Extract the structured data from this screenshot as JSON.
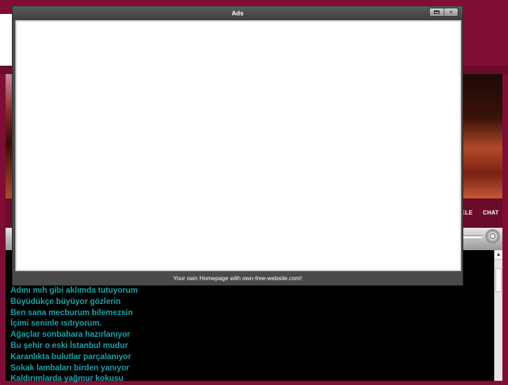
{
  "popup": {
    "title": "Ads",
    "footer_text": "Your own Homepage with own-free-website.com!",
    "maximize_icon": "maximize-icon",
    "close_label": "×"
  },
  "nav": {
    "items": [
      {
        "label": "ELE"
      },
      {
        "label": "CHAT"
      }
    ]
  },
  "player": {
    "knob_icon": "volume-knob-icon"
  },
  "scrollbar": {
    "up_arrow": "▲"
  },
  "lyrics": [
    "Adını mıh gibi aklımda tutuyorum",
    "Büyüdükçe büyüyor gözlerin",
    "Ben sana mecburum bilemezsin",
    "İçimi seninle ısıtıyorum.",
    "Ağaçlar sonbahara hazırlanıyor",
    "Bu şehir o eski İstanbul mudur",
    "Karanlıkta bulutlar parçalanıyor",
    "Sokak lambaları birden yanıyor",
    "Kaldırımlarda yağmur kokusu"
  ],
  "colors": {
    "page_background": "#800d35",
    "lyrics_text": "#16a3a8",
    "content_background": "#000000",
    "popup_frame": "#4a4a4a"
  }
}
